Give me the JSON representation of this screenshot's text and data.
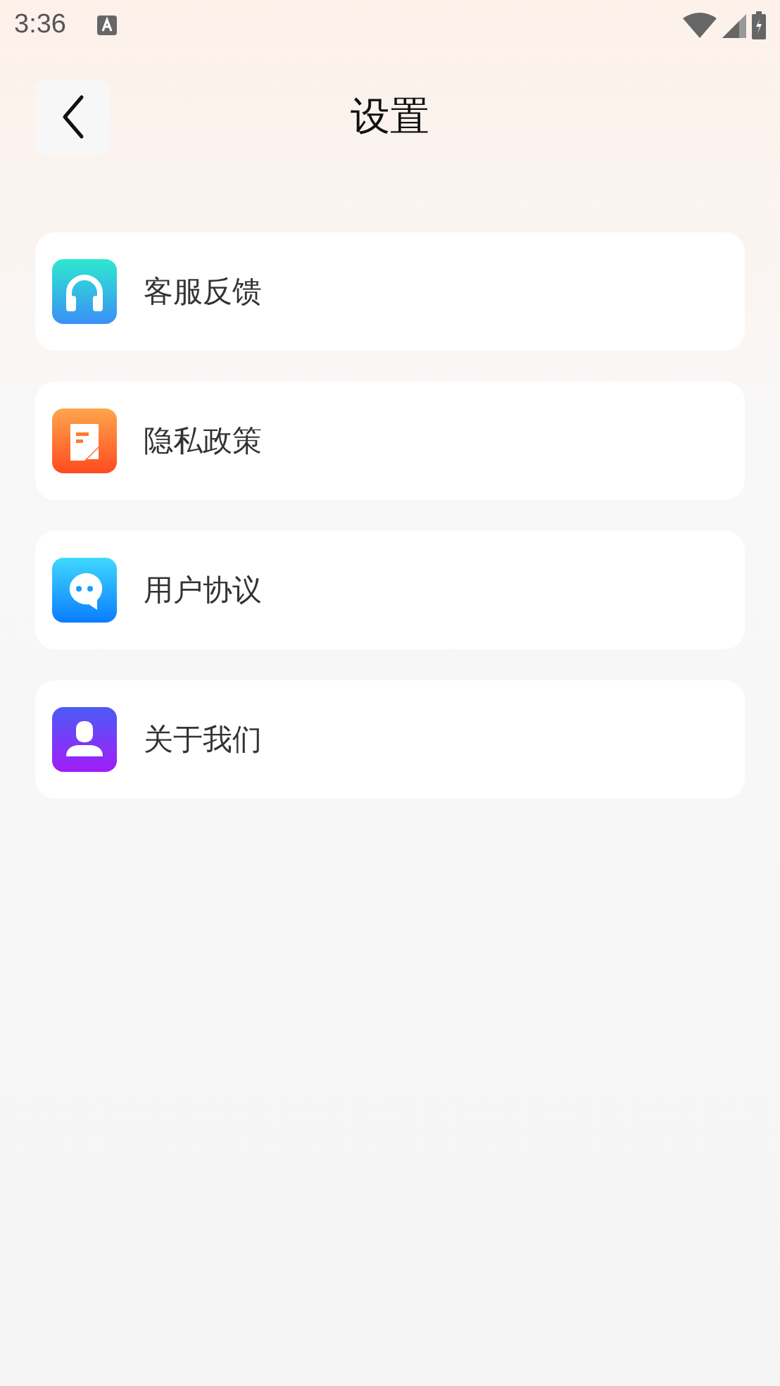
{
  "status_bar": {
    "time": "3:36"
  },
  "header": {
    "title": "设置"
  },
  "items": [
    {
      "label": "客服反馈",
      "kind": "headset"
    },
    {
      "label": "隐私政策",
      "kind": "document"
    },
    {
      "label": "用户协议",
      "kind": "chat"
    },
    {
      "label": "关于我们",
      "kind": "person"
    }
  ]
}
